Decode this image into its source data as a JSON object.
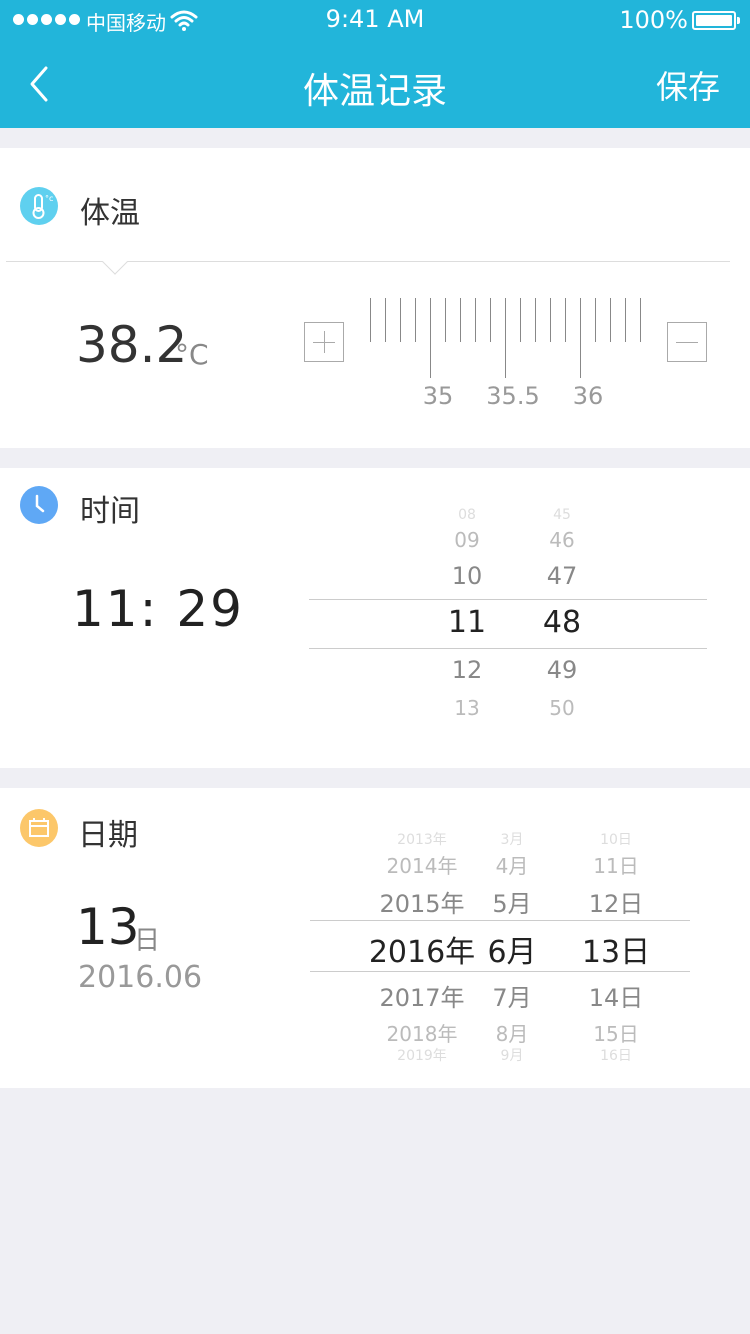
{
  "status_bar": {
    "carrier": "中国移动",
    "time": "9:41 AM",
    "battery": "100%"
  },
  "nav": {
    "title": "体温记录",
    "save_label": "保存",
    "back_icon": "chevron-left-icon"
  },
  "colors": {
    "header": "#22b5da",
    "temp_icon": "#5fd0ef",
    "time_icon": "#5fa8f5",
    "date_icon": "#fcc76a"
  },
  "temperature": {
    "title": "体温",
    "icon": "thermometer-icon",
    "value": "38.2",
    "unit": "°C",
    "ruler_labels": [
      "35",
      "35.5",
      "36"
    ]
  },
  "time": {
    "title": "时间",
    "icon": "clock-icon",
    "display": "11:  29",
    "hours": [
      "08",
      "09",
      "10",
      "11",
      "12",
      "13"
    ],
    "minutes": [
      "45",
      "46",
      "47",
      "48",
      "49",
      "50"
    ],
    "selected_index": 3
  },
  "date": {
    "title": "日期",
    "icon": "calendar-icon",
    "day": "13",
    "day_unit": "日",
    "year_month": "2016.06",
    "years": [
      "2013年",
      "2014年",
      "2015年",
      "2016年",
      "2017年",
      "2018年",
      "2019年"
    ],
    "months": [
      "3月",
      "4月",
      "5月",
      "6月",
      "7月",
      "8月",
      "9月"
    ],
    "days": [
      "10日",
      "11日",
      "12日",
      "13日",
      "14日",
      "15日",
      "16日"
    ],
    "selected_index": 3
  }
}
